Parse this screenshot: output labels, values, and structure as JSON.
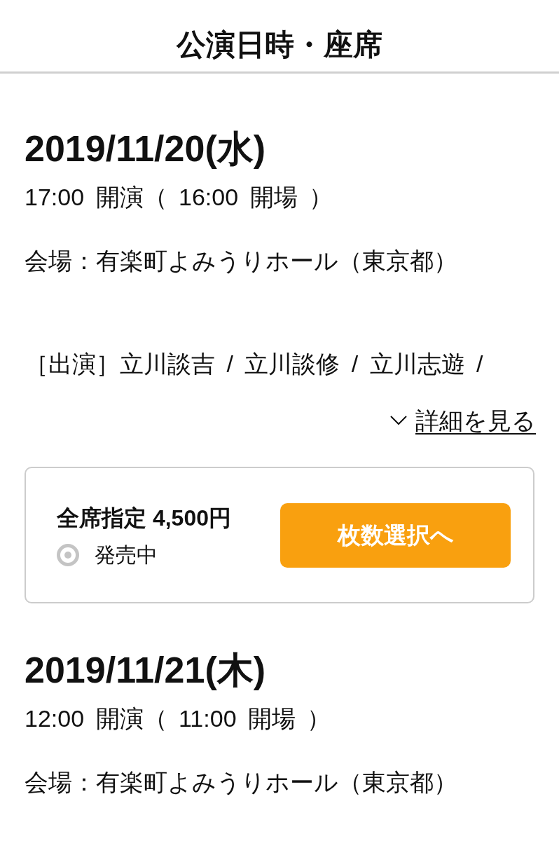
{
  "header": {
    "title": "公演日時・座席"
  },
  "performances": [
    {
      "date": "2019/11/20(水)",
      "time": "17:00 開演（ 16:00 開場 ）",
      "venue": "会場：有楽町よみうりホール（東京都）",
      "cast": "［出演］立川談吉 / 立川談修 / 立川志遊 /",
      "details_link": "詳細を見る",
      "tickets": [
        {
          "label": "全席指定 4,500円",
          "status": "発売中",
          "button": "枚数選択へ"
        }
      ]
    },
    {
      "date": "2019/11/21(木)",
      "time": "12:00 開演（ 11:00 開場 ）",
      "venue": "会場：有楽町よみうりホール（東京都）"
    }
  ]
}
